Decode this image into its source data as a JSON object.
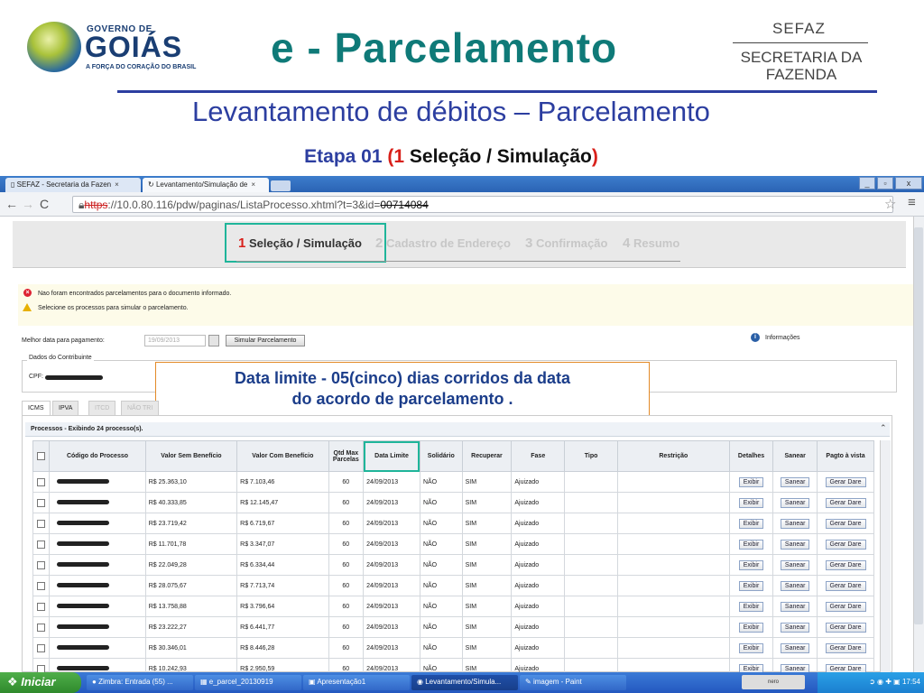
{
  "slide": {
    "logo": {
      "governo": "GOVERNO DE",
      "goias": "GOIÁS",
      "tagline": "A FORÇA DO CORAÇÃO DO BRASIL"
    },
    "title": "e - Parcelamento",
    "sefaz": {
      "line1": "SEFAZ",
      "line2": "SECRETARIA DA",
      "line3": "FAZENDA"
    },
    "subtitle": "Levantamento de débitos – Parcelamento",
    "etapa": {
      "prefix": "Etapa 01",
      "open": "(",
      "num": "1",
      "label": " Seleção / Simulação",
      "close": ")"
    }
  },
  "browser": {
    "tabs": [
      {
        "label": "SEFAZ - Secretaria da Fazen"
      },
      {
        "label": "Levantamento/Simulação de"
      }
    ],
    "url": {
      "scheme": "https",
      "rest": "://10.0.80.116/pdw/paginas/ListaProcesso.xhtml?t=3&id=",
      "redacted": "00714084"
    },
    "win": {
      "min": "_",
      "max": "▫",
      "close": "x"
    }
  },
  "wizard": {
    "steps": [
      {
        "num": "1",
        "label": "Seleção / Simulação"
      },
      {
        "num": "2",
        "label": "Cadastro de Endereço"
      },
      {
        "num": "3",
        "label": "Confirmação"
      },
      {
        "num": "4",
        "label": "Resumo"
      }
    ]
  },
  "messages": {
    "error": "Nao foram encontrados parcelamentos para o documento informado.",
    "warn": "Selecione os processos para simular o parcelamento."
  },
  "form": {
    "date_label": "Melhor data para pagamento:",
    "date_value": "19/09/2013",
    "simular": "Simular Parcelamento",
    "info": "Informações",
    "legend": "Dados do Contribuinte",
    "cpf_label": "CPF:"
  },
  "callout": {
    "line1": "Data limite - 05(cinco) dias corridos da data",
    "line2": "do acordo de parcelamento ."
  },
  "tax_tabs": [
    "ICMS",
    "IPVA",
    "ITCD",
    "NÃO TRI"
  ],
  "panel": {
    "header": "Processos - Exibindo 24 processo(s)."
  },
  "table": {
    "headers": [
      "Código do Processo",
      "Valor Sem Benefício",
      "Valor Com Benefício",
      "Qtd Max Parcelas",
      "Data Limite",
      "Solidário",
      "Recuperar",
      "Fase",
      "Tipo",
      "Restrição",
      "Detalhes",
      "Sanear",
      "Pagto à vista"
    ],
    "buttons": {
      "exibir": "Exibir",
      "sanear": "Sanear",
      "gerar": "Gerar Dare"
    },
    "rows": [
      {
        "sem": "R$ 25.363,10",
        "com": "R$ 7.103,46",
        "qtd": "60",
        "data": "24/09/2013",
        "sol": "NÃO",
        "rec": "SIM",
        "fase": "Ajuizado"
      },
      {
        "sem": "R$ 40.333,85",
        "com": "R$ 12.145,47",
        "qtd": "60",
        "data": "24/09/2013",
        "sol": "NÃO",
        "rec": "SIM",
        "fase": "Ajuizado"
      },
      {
        "sem": "R$ 23.719,42",
        "com": "R$ 6.719,67",
        "qtd": "60",
        "data": "24/09/2013",
        "sol": "NÃO",
        "rec": "SIM",
        "fase": "Ajuizado"
      },
      {
        "sem": "R$ 11.701,78",
        "com": "R$ 3.347,07",
        "qtd": "60",
        "data": "24/09/2013",
        "sol": "NÃO",
        "rec": "SIM",
        "fase": "Ajuizado"
      },
      {
        "sem": "R$ 22.049,28",
        "com": "R$ 6.334,44",
        "qtd": "60",
        "data": "24/09/2013",
        "sol": "NÃO",
        "rec": "SIM",
        "fase": "Ajuizado"
      },
      {
        "sem": "R$ 28.075,67",
        "com": "R$ 7.713,74",
        "qtd": "60",
        "data": "24/09/2013",
        "sol": "NÃO",
        "rec": "SIM",
        "fase": "Ajuizado"
      },
      {
        "sem": "R$ 13.758,88",
        "com": "R$ 3.796,64",
        "qtd": "60",
        "data": "24/09/2013",
        "sol": "NÃO",
        "rec": "SIM",
        "fase": "Ajuizado"
      },
      {
        "sem": "R$ 23.222,27",
        "com": "R$ 6.441,77",
        "qtd": "60",
        "data": "24/09/2013",
        "sol": "NÃO",
        "rec": "SIM",
        "fase": "Ajuizado"
      },
      {
        "sem": "R$ 30.346,01",
        "com": "R$ 8.446,28",
        "qtd": "60",
        "data": "24/09/2013",
        "sol": "NÃO",
        "rec": "SIM",
        "fase": "Ajuizado"
      },
      {
        "sem": "R$ 10.242,93",
        "com": "R$ 2.950,59",
        "qtd": "60",
        "data": "24/09/2013",
        "sol": "NÃO",
        "rec": "SIM",
        "fase": "Ajuizado"
      }
    ]
  },
  "taskbar": {
    "start": "Iniciar",
    "tasks": [
      "Zimbra: Entrada (55) ...",
      "e_parcel_20130919",
      "Apresentação1",
      "Levantamento/Simula...",
      "imagem - Paint"
    ],
    "nero": "nero",
    "clock": "17:54"
  },
  "colors": {
    "teal": "#0f7a78",
    "blue": "#2c3ea0",
    "red": "#d8201a",
    "highlight": "#1fb59a",
    "callout_border": "#e38a27"
  }
}
